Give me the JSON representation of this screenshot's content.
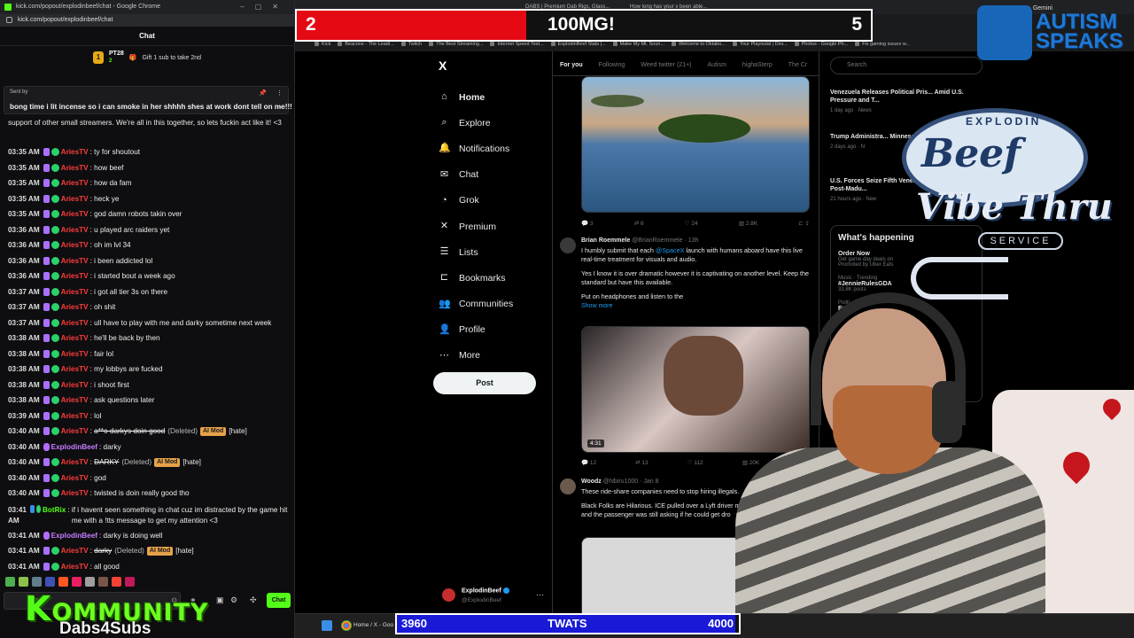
{
  "chat_window": {
    "window_title": "kick.com/popout/explodinbeef/chat - Google Chrome",
    "url": "kick.com/popout/explodinbeef/chat",
    "header": "Chat",
    "sub_banner": {
      "user": "PT28",
      "count": "2",
      "text": "Gift 1 sub to take 2nd"
    },
    "pinned": {
      "sent_by": "Sent by",
      "message": "bong time i lit incense so i can smoke in her shhhh shes at work dont tell on me!!!"
    },
    "intro_text": "support of other small streamers. We're all in this together, so lets fuckin act like it! <3",
    "messages": [
      {
        "time": "03:35 AM",
        "user": "AriesTV",
        "text": "ty for shoutout"
      },
      {
        "time": "03:35 AM",
        "user": "AriesTV",
        "text": "how beef"
      },
      {
        "time": "03:35 AM",
        "user": "AriesTV",
        "text": "how da fam"
      },
      {
        "time": "03:35 AM",
        "user": "AriesTV",
        "text": "heck ye"
      },
      {
        "time": "03:35 AM",
        "user": "AriesTV",
        "text": "god damn robots takin over"
      },
      {
        "time": "03:36 AM",
        "user": "AriesTV",
        "text": "u played arc raiders yet"
      },
      {
        "time": "03:36 AM",
        "user": "AriesTV",
        "text": "oh im lvl 34"
      },
      {
        "time": "03:36 AM",
        "user": "AriesTV",
        "text": "i been addicted lol"
      },
      {
        "time": "03:36 AM",
        "user": "AriesTV",
        "text": "i started bout a week ago"
      },
      {
        "time": "03:37 AM",
        "user": "AriesTV",
        "text": "i got all tier 3s on there"
      },
      {
        "time": "03:37 AM",
        "user": "AriesTV",
        "text": "oh shit"
      },
      {
        "time": "03:37 AM",
        "user": "AriesTV",
        "text": "ull have to play with me and darky sometime next week"
      },
      {
        "time": "03:38 AM",
        "user": "AriesTV",
        "text": "he'll be back by then"
      },
      {
        "time": "03:38 AM",
        "user": "AriesTV",
        "text": "fair lol"
      },
      {
        "time": "03:38 AM",
        "user": "AriesTV",
        "text": "my lobbys are fucked"
      },
      {
        "time": "03:38 AM",
        "user": "AriesTV",
        "text": "i shoot first"
      },
      {
        "time": "03:38 AM",
        "user": "AriesTV",
        "text": "ask questions later"
      },
      {
        "time": "03:39 AM",
        "user": "AriesTV",
        "text": "lol"
      },
      {
        "time": "03:40 AM",
        "user": "AriesTV",
        "text": "a**o darkys doin good",
        "deleted": "(Deleted)",
        "mod": "AI Mod",
        "tag": "[hate]"
      },
      {
        "time": "03:40 AM",
        "user": "ExplodinBeef",
        "text": "darky"
      },
      {
        "time": "03:40 AM",
        "user": "AriesTV",
        "text": "DARKY",
        "deleted": "(Deleted)",
        "mod": "AI Mod",
        "tag": "[hate]"
      },
      {
        "time": "03:40 AM",
        "user": "AriesTV",
        "text": "god"
      },
      {
        "time": "03:40 AM",
        "user": "AriesTV",
        "text": "twisted is doin really good tho"
      },
      {
        "time": "03:41 AM",
        "user": "BotRix",
        "text": "if i havent seen something in chat cuz im distracted by the game hit me with a !tts message to get my attention <3"
      },
      {
        "time": "03:41 AM",
        "user": "ExplodinBeef",
        "text": "darky is doing well"
      },
      {
        "time": "03:41 AM",
        "user": "AriesTV",
        "text": "darky",
        "deleted": "(Deleted)",
        "mod": "AI Mod",
        "tag": "[hate]"
      },
      {
        "time": "03:41 AM",
        "user": "AriesTV",
        "text": "all good"
      }
    ],
    "input_placeholder": "ssage",
    "chat_button": "Chat",
    "overlay_kommunity": "OMMUNITY",
    "overlay_k": "K",
    "overlay_dabs": "Dabs4Subs"
  },
  "browser": {
    "tabs": [
      "DABS | Premium Dab Rigs, Glass...",
      "How long has your x been able..."
    ],
    "gemini": "Gemini",
    "bookmarks": [
      "Kick",
      "Beacons - The Leadi...",
      "Twitch",
      "The Best Streaming...",
      "Internet Speed Test...",
      "ExplodinBeef Stats |...",
      "Make My Mt. Soun...",
      "Welcome to Oktabo...",
      "Your Playoutal | Dev...",
      "Photos - Google Ph...",
      "Fix gaming issues w..."
    ]
  },
  "goal_top": {
    "current": "2",
    "label": "100MG!",
    "target": "5",
    "progress": 0.4,
    "fill_color": "#e50914"
  },
  "xapp": {
    "logo": "X",
    "nav": [
      {
        "label": "Home",
        "icon": "home-icon"
      },
      {
        "label": "Explore",
        "icon": "search-icon"
      },
      {
        "label": "Notifications",
        "icon": "bell-icon"
      },
      {
        "label": "Chat",
        "icon": "mail-icon"
      },
      {
        "label": "Grok",
        "icon": "grok-icon"
      },
      {
        "label": "Premium",
        "icon": "x-icon"
      },
      {
        "label": "Lists",
        "icon": "list-icon"
      },
      {
        "label": "Bookmarks",
        "icon": "bookmark-icon"
      },
      {
        "label": "Communities",
        "icon": "people-icon"
      },
      {
        "label": "Profile",
        "icon": "person-icon"
      },
      {
        "label": "More",
        "icon": "more-icon"
      }
    ],
    "post_button": "Post",
    "account": {
      "name": "ExplodinBeef",
      "handle": "@ExplodinBeef"
    },
    "feed_tabs": [
      "For you",
      "Following",
      "Weed twitter (21+)",
      "Autism",
      "highaSterp",
      "The Cr"
    ],
    "tweet1_actions": {
      "replies": "3",
      "reposts": "6",
      "likes": "24",
      "views": "2.8K"
    },
    "tweet2": {
      "name": "Brian Roemmele",
      "handle": "@BrianRoemmele · 13h",
      "line1": "I humbly submit that each",
      "mention": "@SpaceX",
      "line1b": "launch with humans aboard have this live real-time treatment for visuals and audio.",
      "line2": "Yes I know it is over dramatic however it is captivating on another level. Keep the standard but have this available.",
      "line3": "Put on headphones and listen to the",
      "show_more": "Show more",
      "duration": "4:31",
      "replies": "12",
      "reposts": "13",
      "likes": "112",
      "views": "20K"
    },
    "tweet3": {
      "name": "Woodz",
      "handle": "@Nbiru1000 · Jan 8",
      "line1": "These ride-share companies need to stop hiring illegals.",
      "line2": "Black Folks are Hilarious. ICE pulled over a Lyft driver m",
      "line3": "and the passenger was still asking if he could get dro"
    },
    "search_placeholder": "Search",
    "news": [
      {
        "title": "Venezuela Releases Political Pris... Amid U.S. Pressure and T...",
        "meta": "1 day ago · News"
      },
      {
        "title": "Trump Administra... Minnesota Welfare F...",
        "meta": "2 days ago · N"
      },
      {
        "title": "U.S. Forces Seize Fifth Venezuelan Tanker Amid Post-Madu...",
        "meta": "21 hours ago · New"
      }
    ],
    "happening_title": "What's happening",
    "happening": [
      {
        "title": "Order Now",
        "sub": "Get game day deals on",
        "meta": "Promoted by Uber Eats"
      },
      {
        "title": "#JennieRulesGDA",
        "sub": "Music · Trending",
        "meta": "33.8K posts"
      },
      {
        "title": "Eri",
        "sub": "Politi",
        "meta": ""
      }
    ]
  },
  "overlays": {
    "autism_speaks": "AUTISM SPEAKS",
    "logo_top": "EXPLODIN",
    "logo_beef": "Beef",
    "logo_vibe": "Vibe Thru",
    "logo_service": "SERVICE"
  },
  "taskbar": {
    "window_label": "Home / X - Goo"
  },
  "goal_bottom": {
    "current": "3960",
    "label": "TWATS",
    "target": "4000",
    "progress": 0.99,
    "fill_color": "#1a1ad6"
  }
}
